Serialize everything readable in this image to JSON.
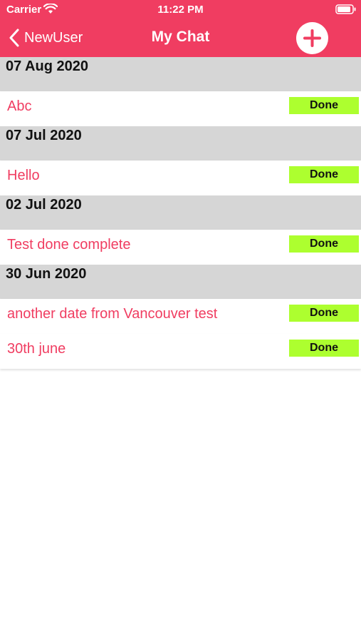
{
  "status_bar": {
    "carrier": "Carrier",
    "time": "11:22 PM"
  },
  "nav": {
    "back_label": "NewUser",
    "title": "My Chat",
    "back_icon": "chevron-left-icon",
    "add_icon": "plus-icon"
  },
  "colors": {
    "accent": "#f03d61",
    "section_bg": "#d6d6d6",
    "done_bg": "#adff2f"
  },
  "sections": [
    {
      "date": "07 Aug 2020",
      "items": [
        {
          "title": "Abc",
          "action": "Done"
        }
      ]
    },
    {
      "date": "07 Jul 2020",
      "items": [
        {
          "title": "Hello",
          "action": "Done"
        }
      ]
    },
    {
      "date": "02 Jul 2020",
      "items": [
        {
          "title": "Test done complete",
          "action": "Done"
        }
      ]
    },
    {
      "date": "30 Jun 2020",
      "items": [
        {
          "title": "another date from Vancouver test",
          "action": "Done"
        },
        {
          "title": "30th june",
          "action": "Done"
        }
      ]
    }
  ]
}
